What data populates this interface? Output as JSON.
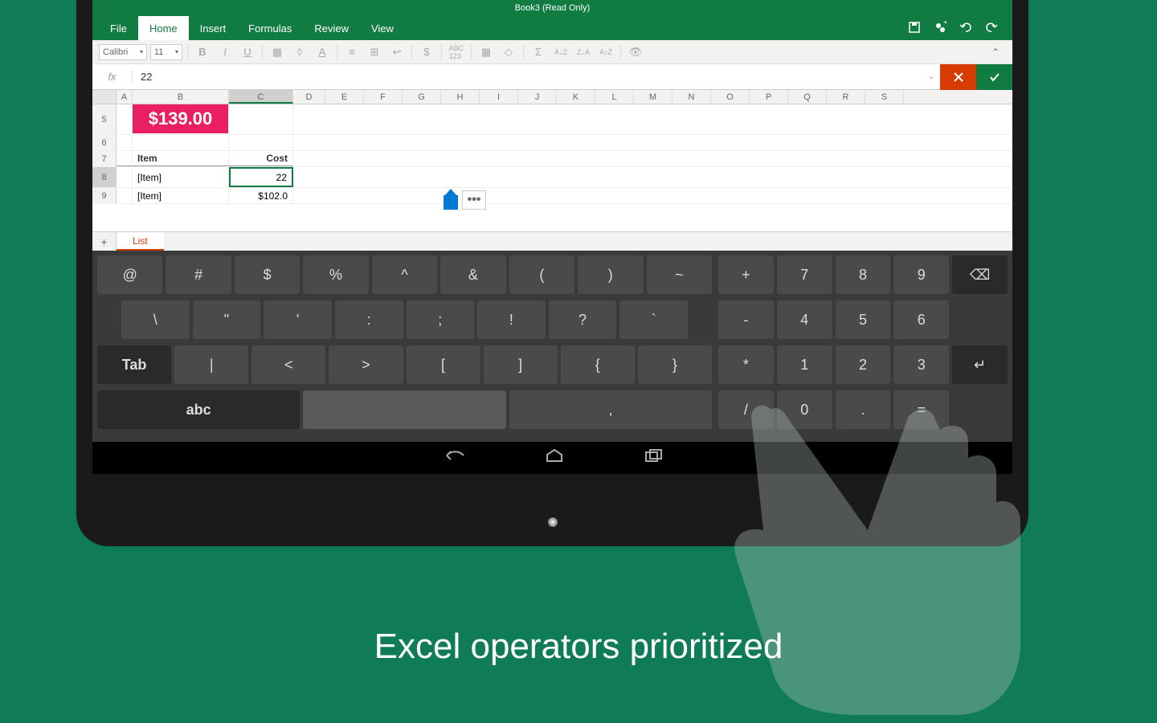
{
  "titlebar": "Book3 (Read Only)",
  "tabs": {
    "file": "File",
    "home": "Home",
    "insert": "Insert",
    "formulas": "Formulas",
    "review": "Review",
    "view": "View"
  },
  "toolbar": {
    "font": "Calibri",
    "size": "11"
  },
  "formula": {
    "fx": "fx",
    "value": "22"
  },
  "columns": [
    "A",
    "B",
    "C",
    "D",
    "E",
    "F",
    "G",
    "H",
    "I",
    "J",
    "K",
    "L",
    "M",
    "N",
    "O",
    "P",
    "Q",
    "R",
    "S"
  ],
  "rows": {
    "price": "$139.00",
    "r5": "5",
    "r6": "6",
    "r7": "7",
    "r8": "8",
    "r9": "9",
    "h_item": "Item",
    "h_cost": "Cost",
    "d8_item": "[Item]",
    "d8_cost": "22",
    "d9_item": "[Item]",
    "d9_cost": "$102.0"
  },
  "more": "•••",
  "sheet": {
    "add": "+",
    "name": "List"
  },
  "keyboard": {
    "r1": [
      "@",
      "#",
      "$",
      "%",
      "^",
      "&",
      "(",
      ")",
      "~"
    ],
    "r2": [
      "\\",
      "\"",
      "'",
      ":",
      ";",
      "!",
      "?",
      "`"
    ],
    "r3": [
      "Tab",
      "|",
      "<",
      ">",
      "[",
      "]",
      "{",
      "}"
    ],
    "abc": "abc",
    "comma": ",",
    "op": [
      "+",
      "-",
      "*",
      "/"
    ],
    "num": [
      [
        "7",
        "8",
        "9"
      ],
      [
        "4",
        "5",
        "6"
      ],
      [
        "1",
        "2",
        "3"
      ],
      [
        "0",
        ".",
        "="
      ]
    ],
    "bksp": "⌫",
    "enter": "↵"
  },
  "tagline": "Excel operators prioritized"
}
